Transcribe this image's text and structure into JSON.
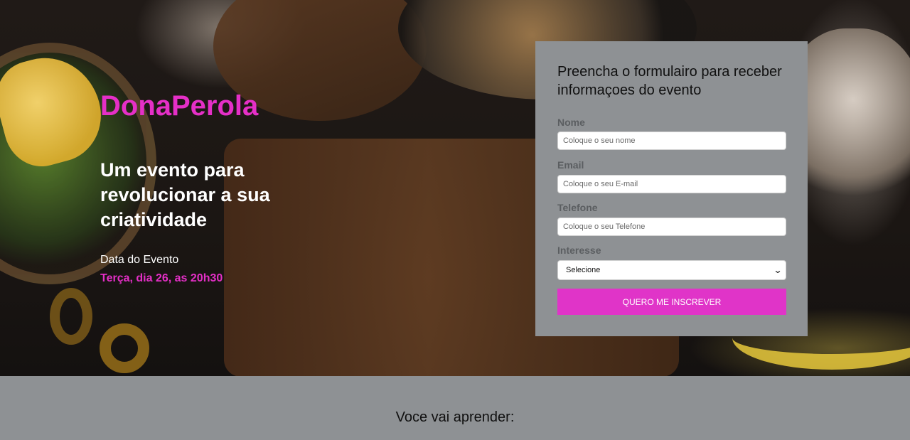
{
  "hero": {
    "brand": "DonaPerola",
    "headline": "Um evento para revolucionar a sua criatividade",
    "date_label": "Data do Evento",
    "date_value": "Terça, dia 26, as 20h30"
  },
  "form": {
    "title": "Preencha o formulairo para receber informaçoes do evento",
    "fields": [
      {
        "label": "Nome",
        "placeholder": "Coloque o seu nome"
      },
      {
        "label": "Email",
        "placeholder": "Coloque o seu E-mail"
      },
      {
        "label": "Telefone",
        "placeholder": "Coloque o seu Telefone"
      }
    ],
    "interest": {
      "label": "Interesse",
      "selected": "Selecione"
    },
    "submit_label": "QUERO ME INSCREVER"
  },
  "learn": {
    "title": "Voce vai aprender:"
  },
  "colors": {
    "accent": "#e034c8",
    "brand_pink": "#e52fc7",
    "form_background": "#8e9194"
  }
}
